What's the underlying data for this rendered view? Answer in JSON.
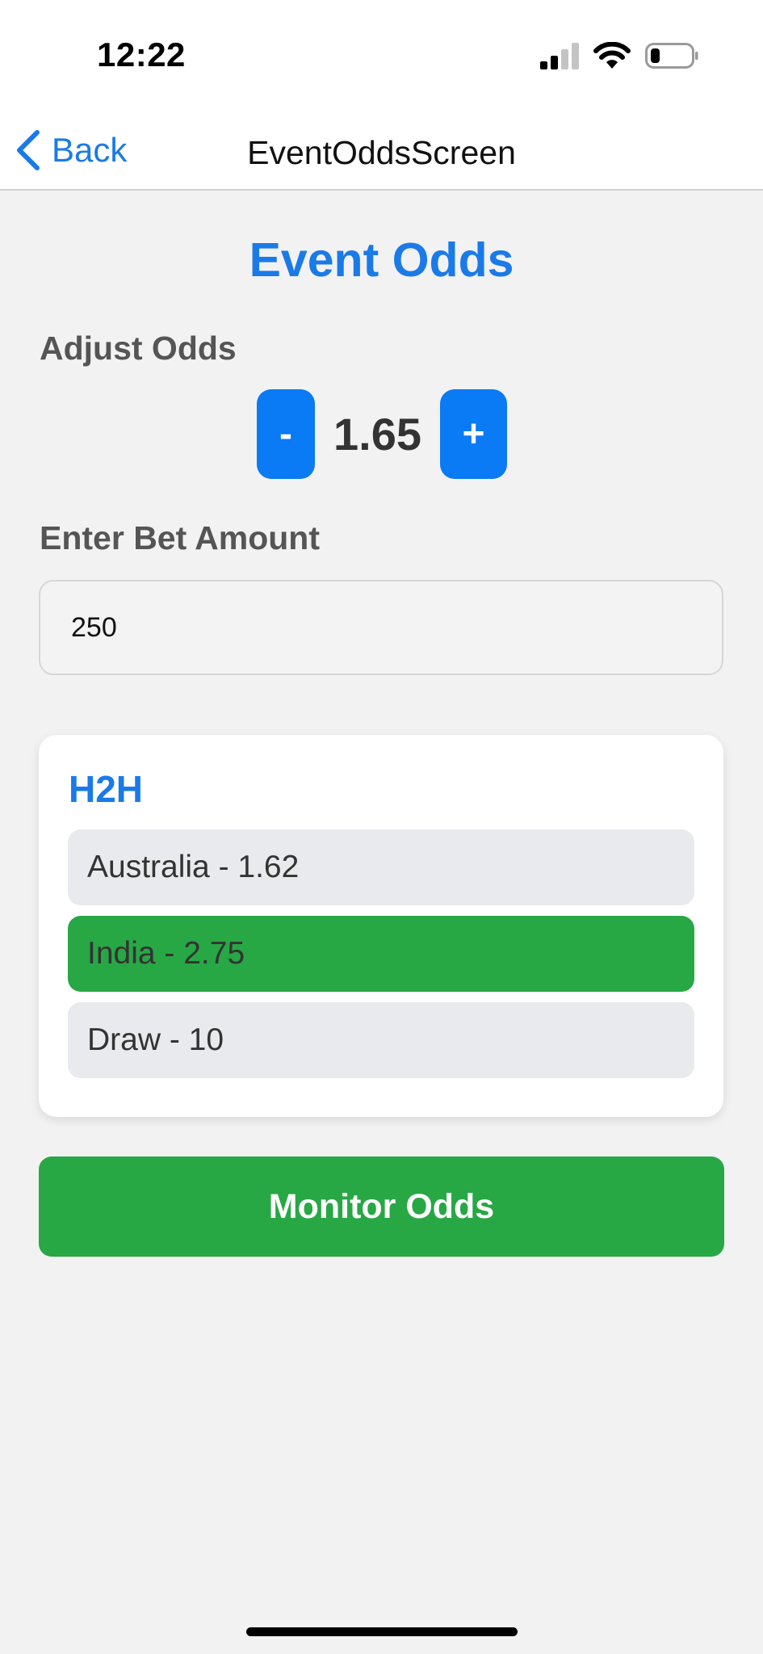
{
  "status_bar": {
    "time": "12:22",
    "icons": [
      "cellular-signal-icon",
      "wifi-icon",
      "battery-icon"
    ]
  },
  "nav": {
    "back_label": "Back",
    "title": "EventOddsScreen"
  },
  "page": {
    "title": "Event Odds",
    "adjust_label": "Adjust Odds",
    "decrement_label": "-",
    "increment_label": "+",
    "odds_value": "1.65",
    "bet_label": "Enter Bet Amount",
    "bet_value": "250"
  },
  "market": {
    "title": "H2H",
    "outcomes": [
      {
        "label": "Australia - 1.62",
        "selected": false
      },
      {
        "label": "India - 2.75",
        "selected": true
      },
      {
        "label": "Draw - 10",
        "selected": false
      }
    ]
  },
  "monitor_button_label": "Monitor Odds",
  "colors": {
    "accent": "#1a7ae8",
    "button_blue": "#0a7af5",
    "selected_green": "#28a745",
    "unselected_gray": "#e8eaed",
    "background": "#f2f2f2"
  }
}
